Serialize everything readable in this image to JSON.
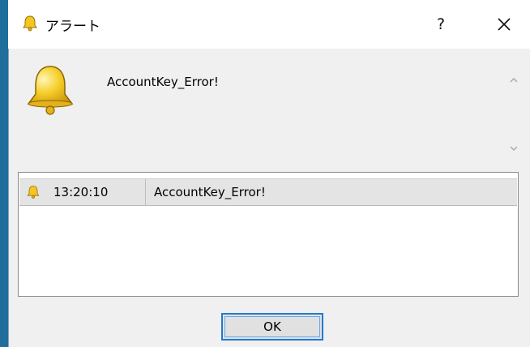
{
  "window": {
    "title": "アラート",
    "help_label": "?"
  },
  "alert": {
    "message": "AccountKey_Error!"
  },
  "log": {
    "rows": [
      {
        "time": "13:20:10",
        "message": "AccountKey_Error!"
      }
    ]
  },
  "buttons": {
    "ok_label": "OK"
  },
  "colors": {
    "accent": "#1e7bd6",
    "bell_gold": "#f3c622",
    "background": "#f0f0f0"
  },
  "icons": {
    "app": "bell-icon",
    "close": "close-icon",
    "scroll_up": "chevron-up-icon",
    "scroll_down": "chevron-down-icon"
  }
}
